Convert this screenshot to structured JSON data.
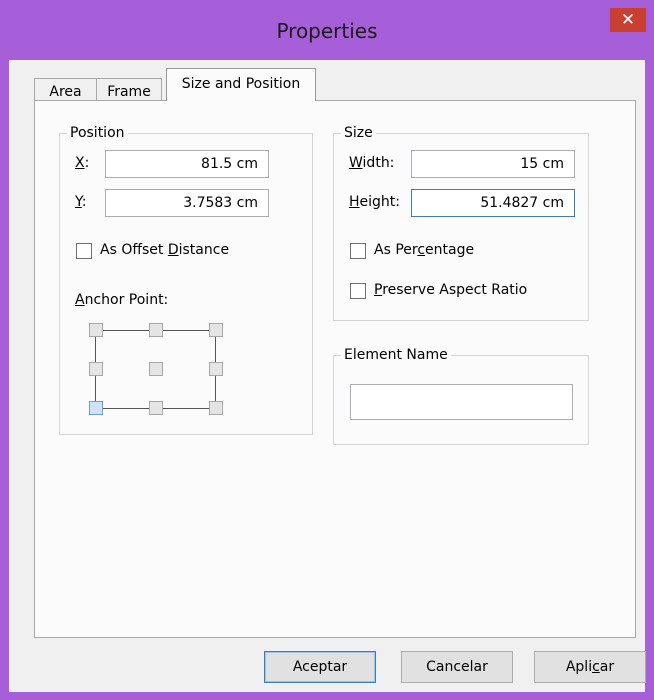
{
  "window": {
    "title": "Properties",
    "close_glyph": "✕"
  },
  "tabs": [
    {
      "label": "Area"
    },
    {
      "label": "Frame"
    },
    {
      "label": "Size and Position"
    }
  ],
  "position": {
    "group_label": "Position",
    "x_label": "X:",
    "x_value": "81.5 cm",
    "y_label": "Y:",
    "y_value": "3.7583 cm",
    "as_offset_label": "As Offset Distance",
    "as_offset_checked": false,
    "anchor_label": "Anchor Point:",
    "anchor_selected": "bottom-left"
  },
  "size": {
    "group_label": "Size",
    "width_label": "Width:",
    "width_value": "15 cm",
    "height_label": "Height:",
    "height_value": "51.4827 cm",
    "as_percentage_label": "As Percentage",
    "as_percentage_checked": false,
    "preserve_label": "Preserve Aspect Ratio",
    "preserve_checked": false
  },
  "element_name": {
    "group_label": "Element Name",
    "value": ""
  },
  "buttons": {
    "ok": "Aceptar",
    "cancel": "Cancelar",
    "apply": "Aplicar"
  },
  "colors": {
    "title_bar": "#a75fd9",
    "close_button": "#c94032",
    "focus_border": "#3c7fb1"
  }
}
